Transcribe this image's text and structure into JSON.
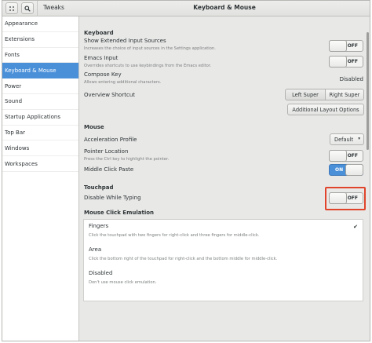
{
  "header": {
    "app_title": "Tweaks",
    "page_title": "Keyboard & Mouse",
    "menu_icon": "menu-icon",
    "search_icon": "search-icon"
  },
  "sidebar": {
    "items": [
      {
        "label": "Appearance",
        "active": false
      },
      {
        "label": "Extensions",
        "active": false
      },
      {
        "label": "Fonts",
        "active": false
      },
      {
        "label": "Keyboard & Mouse",
        "active": true
      },
      {
        "label": "Power",
        "active": false
      },
      {
        "label": "Sound",
        "active": false
      },
      {
        "label": "Startup Applications",
        "active": false
      },
      {
        "label": "Top Bar",
        "active": false
      },
      {
        "label": "Windows",
        "active": false
      },
      {
        "label": "Workspaces",
        "active": false
      }
    ]
  },
  "keyboard": {
    "title": "Keyboard",
    "extended_sources": {
      "label": "Show Extended Input Sources",
      "desc": "Increases the choice of input sources in the Settings application.",
      "state": "OFF"
    },
    "emacs": {
      "label": "Emacs Input",
      "desc": "Overrides shortcuts to use keybindings from the Emacs editor.",
      "state": "OFF"
    },
    "compose": {
      "label": "Compose Key",
      "desc": "Allows entering additional characters.",
      "value": "Disabled"
    },
    "overview": {
      "label": "Overview Shortcut",
      "left": "Left Super",
      "right": "Right Super"
    },
    "layout_button": "Additional Layout Options"
  },
  "mouse": {
    "title": "Mouse",
    "accel": {
      "label": "Acceleration Profile",
      "value": "Default",
      "arrow_icon": "chevron-down-icon"
    },
    "pointer": {
      "label": "Pointer Location",
      "desc": "Press the Ctrl key to highlight the pointer.",
      "state": "OFF"
    },
    "middle": {
      "label": "Middle Click Paste",
      "state": "ON"
    }
  },
  "touchpad": {
    "title": "Touchpad",
    "dwt": {
      "label": "Disable While Typing",
      "state": "OFF"
    }
  },
  "emulation": {
    "title": "Mouse Click Emulation",
    "check": "✔",
    "options": [
      {
        "label": "Fingers",
        "desc": "Click the touchpad with two fingers for right-click and three fingers for middle-click.",
        "selected": true
      },
      {
        "label": "Area",
        "desc": "Click the bottom right of the touchpad for right-click and the bottom middle for middle-click.",
        "selected": false
      },
      {
        "label": "Disabled",
        "desc": "Don't use mouse click emulation.",
        "selected": false
      }
    ]
  },
  "colors": {
    "accent": "#4a90d9",
    "highlight": "#e0452b"
  }
}
